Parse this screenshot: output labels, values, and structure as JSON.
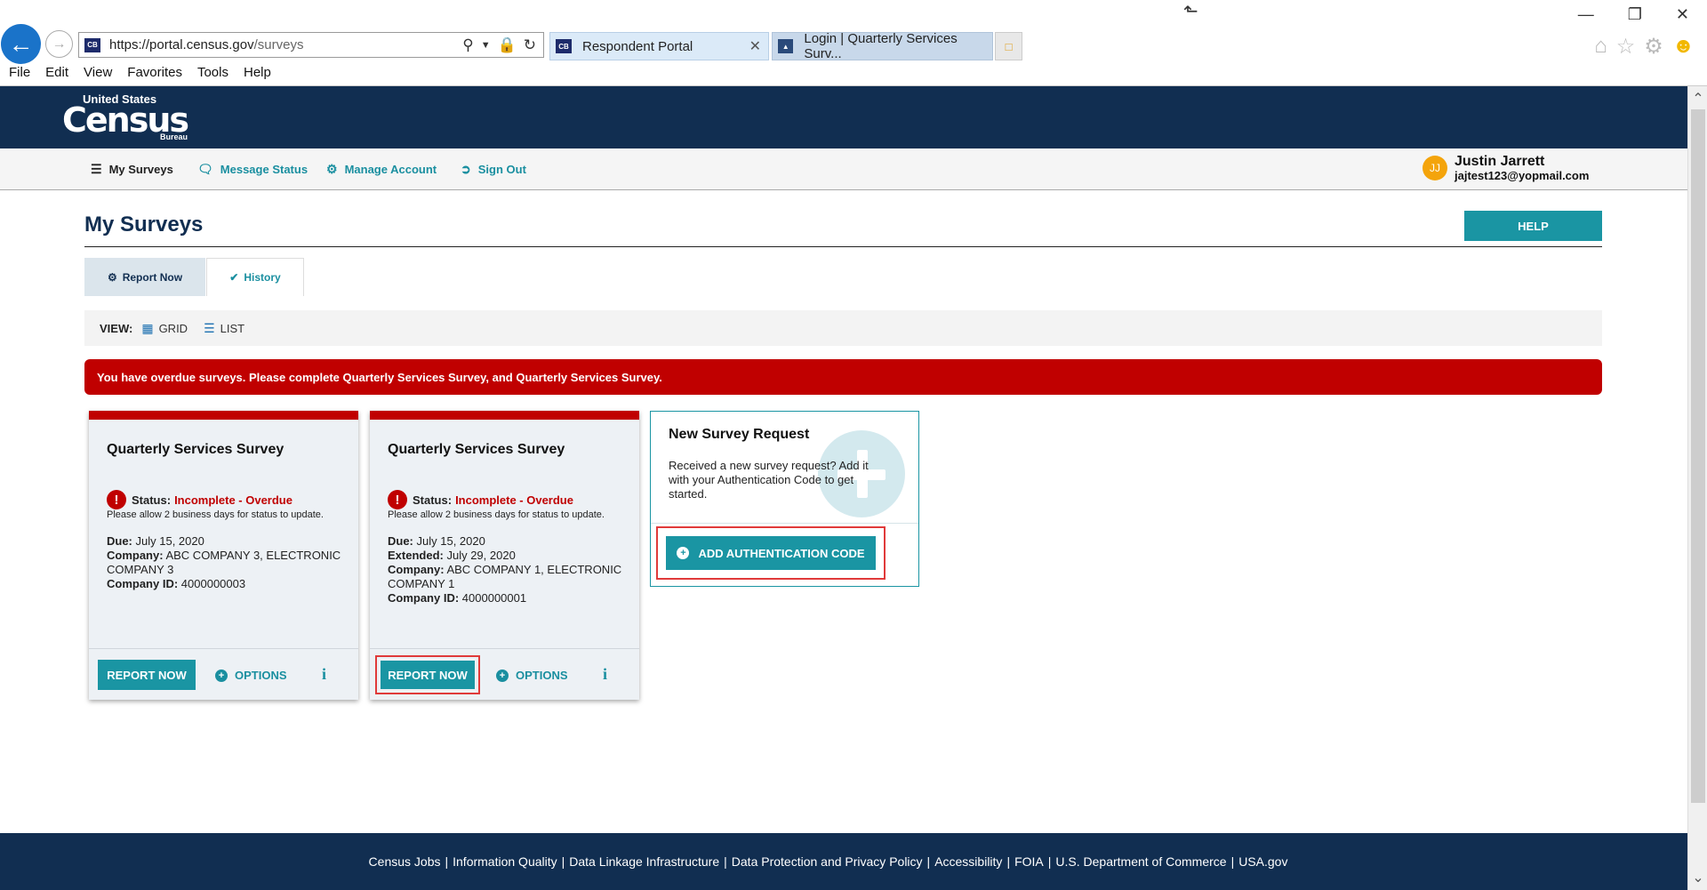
{
  "browser": {
    "url_host": "https://portal.census.gov",
    "url_path": "/surveys",
    "tabs": [
      {
        "label": "Respondent Portal"
      },
      {
        "label": "Login | Quarterly Services Surv..."
      }
    ],
    "menu": [
      "File",
      "Edit",
      "View",
      "Favorites",
      "Tools",
      "Help"
    ]
  },
  "logo": {
    "line1": "United States",
    "line2": "Census",
    "line3": "Bureau"
  },
  "nav": {
    "my_surveys": "My Surveys",
    "message_status": "Message Status",
    "manage_account": "Manage Account",
    "sign_out": "Sign Out"
  },
  "user": {
    "initials": "JJ",
    "name": "Justin Jarrett",
    "email": "jajtest123@yopmail.com"
  },
  "page": {
    "title": "My Surveys",
    "help": "HELP",
    "tabs": {
      "report_now": "Report Now",
      "history": "History"
    },
    "view_label": "VIEW:",
    "view_grid": "GRID",
    "view_list": "LIST",
    "alert": "You have overdue surveys. Please complete Quarterly Services Survey, and Quarterly Services Survey."
  },
  "cards": [
    {
      "title": "Quarterly Services Survey",
      "status_label": "Status:",
      "status_value": "Incomplete - Overdue",
      "note": "Please allow 2 business days for status to update.",
      "due_label": "Due:",
      "due": "July 15, 2020",
      "company_label": "Company:",
      "company": "ABC COMPANY 3, ELECTRONIC COMPANY 3",
      "company_id_label": "Company ID:",
      "company_id": "4000000003",
      "report": "REPORT NOW",
      "options": "OPTIONS"
    },
    {
      "title": "Quarterly Services Survey",
      "status_label": "Status:",
      "status_value": "Incomplete - Overdue",
      "note": "Please allow 2 business days for status to update.",
      "due_label": "Due:",
      "due": "July 15, 2020",
      "extended_label": "Extended:",
      "extended": "July 29, 2020",
      "company_label": "Company:",
      "company": "ABC COMPANY 1, ELECTRONIC COMPANY 1",
      "company_id_label": "Company ID:",
      "company_id": "4000000001",
      "report": "REPORT NOW",
      "options": "OPTIONS"
    }
  ],
  "new_survey": {
    "title": "New Survey Request",
    "desc": "Received a new survey request? Add it with your Authentication Code to get started.",
    "button": "ADD AUTHENTICATION CODE"
  },
  "footer": {
    "links": [
      "Census Jobs",
      "Information Quality",
      "Data Linkage Infrastructure",
      "Data Protection and Privacy Policy",
      "Accessibility",
      "FOIA",
      "U.S. Department of Commerce",
      "USA.gov"
    ]
  },
  "colors": {
    "navy": "#112e51",
    "teal": "#1a95a3",
    "alert_red": "#c00000",
    "highlight": "#e03a3a"
  }
}
